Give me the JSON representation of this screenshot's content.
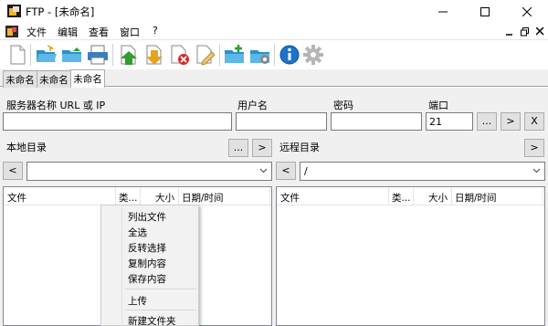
{
  "window": {
    "title": "FTP - [未命名]"
  },
  "menubar": {
    "items": [
      "文件",
      "编辑",
      "查看",
      "窗口",
      "?"
    ]
  },
  "toolbar": {
    "buttons": [
      "new-doc-icon",
      "open-folder-icon",
      "save-folder-icon",
      "print-icon",
      "upload-icon",
      "download-icon",
      "delete-icon",
      "edit-icon",
      "new-folder-icon",
      "properties-icon",
      "info-icon",
      "settings-icon"
    ]
  },
  "tabs": [
    "未命名",
    "未命名",
    "未命名"
  ],
  "connection": {
    "server_label": "服务器名称 URL 或 IP",
    "server_value": "",
    "user_label": "用户名",
    "user_value": "",
    "password_label": "密码",
    "password_value": "",
    "port_label": "端口",
    "port_value": "21",
    "browse_label": "...",
    "connect_label": ">",
    "disconnect_label": "X"
  },
  "local": {
    "label": "本地目录",
    "browse_label": "...",
    "go_label": ">",
    "back_label": "<",
    "path": "",
    "columns": [
      "文件",
      "类...",
      "大小",
      "日期/时间"
    ]
  },
  "remote": {
    "label": "远程目录",
    "go_label": ">",
    "back_label": "<",
    "path": "/",
    "columns": [
      "文件",
      "类...",
      "大小",
      "日期/时间"
    ]
  },
  "context_menu": {
    "items": [
      "列出文件",
      "全选",
      "反转选择",
      "复制内容",
      "保存内容",
      "上传",
      "新建文件夹"
    ]
  },
  "colors": {
    "upload": "#2e9e2e",
    "download": "#e8a31c",
    "delete": "#d42a2a",
    "info": "#1e73c9",
    "folder": "#3ba3d8"
  }
}
